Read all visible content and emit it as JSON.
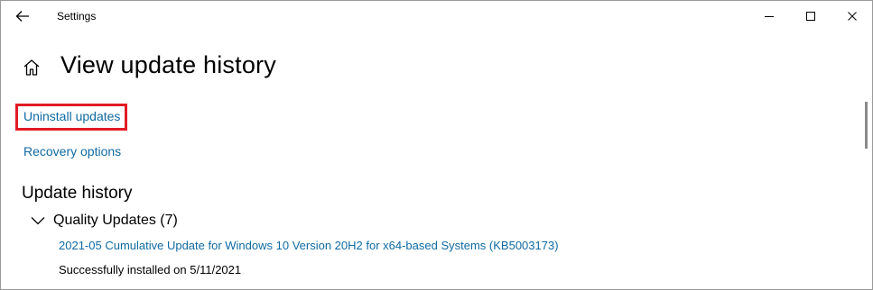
{
  "window": {
    "title": "Settings",
    "controls": {
      "minimize": "minimize-icon",
      "maximize": "maximize-icon",
      "close": "close-icon"
    }
  },
  "header": {
    "title": "View update history",
    "home_icon": "home-icon"
  },
  "links": {
    "uninstall": "Uninstall updates",
    "recovery": "Recovery options"
  },
  "history": {
    "title": "Update history",
    "groups": [
      {
        "label": "Quality Updates (7)",
        "expanded": true,
        "items": [
          {
            "name": "2021-05 Cumulative Update for Windows 10 Version 20H2 for x64-based Systems (KB5003173)",
            "status": "Successfully installed on 5/11/2021"
          }
        ]
      }
    ]
  },
  "colors": {
    "link": "#0f6aa3",
    "highlight": "#e01b24"
  }
}
